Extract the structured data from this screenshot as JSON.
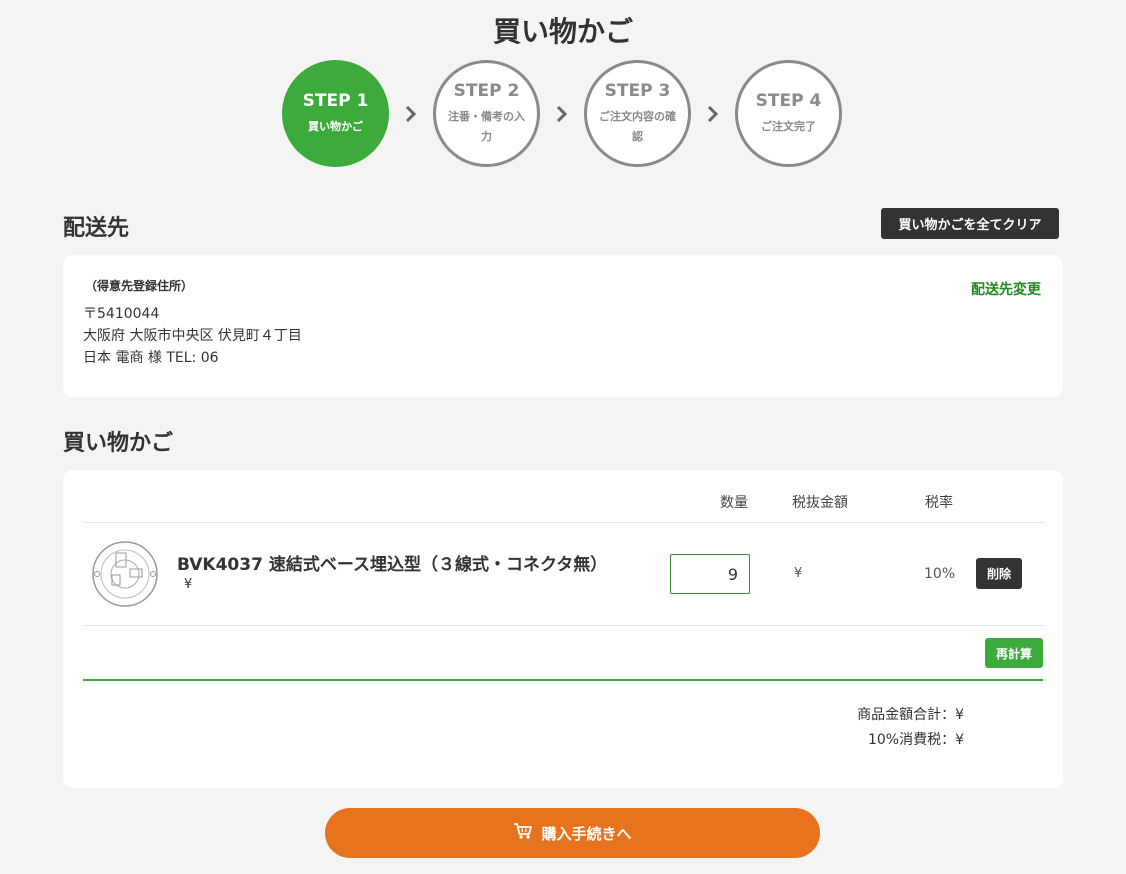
{
  "page": {
    "title": "買い物かご"
  },
  "steps": [
    {
      "num": "STEP 1",
      "label": "買い物かご",
      "active": true
    },
    {
      "num": "STEP 2",
      "label": "注番・備考の入力",
      "active": false
    },
    {
      "num": "STEP 3",
      "label": "ご注文内容の確認",
      "active": false
    },
    {
      "num": "STEP 4",
      "label": "ご注文完了",
      "active": false
    }
  ],
  "shipping": {
    "heading": "配送先",
    "clear_cart_label": "買い物かごを全てクリア",
    "address_type": "（得意先登録住所）",
    "postal": "〒5410044",
    "address": "大阪府 大阪市中央区 伏見町４丁目",
    "recipient": "日本 電商 様 TEL: 06",
    "change_label": "配送先変更"
  },
  "cart": {
    "heading": "買い物かご",
    "columns": {
      "qty": "数量",
      "subtotal": "税抜金額",
      "tax_rate": "税率"
    },
    "items": [
      {
        "name": "BVK4037 速結式ベース埋込型（３線式・コネクタ無）",
        "unit_price": "¥",
        "quantity": "9",
        "subtotal": "¥",
        "tax_rate": "10%",
        "delete_label": "削除"
      }
    ],
    "recalc_label": "再計算",
    "totals": {
      "goods_total": "商品金額合計：¥",
      "tax": "10%消費税：¥"
    }
  },
  "checkout": {
    "label": "購入手続きへ"
  },
  "colors": {
    "accent_green": "#3dab3b",
    "checkout_orange": "#e8731e",
    "dark_button": "#333333"
  },
  "icons": {
    "step_arrow": "chevron-right-icon",
    "cart": "cart-icon"
  }
}
